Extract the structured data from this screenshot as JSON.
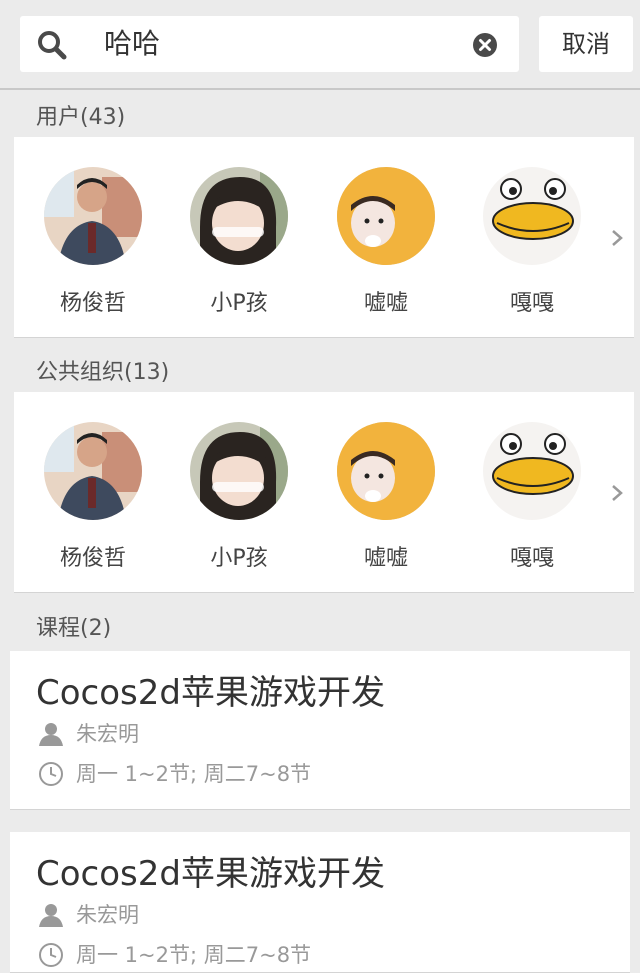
{
  "search": {
    "query": "哈哈",
    "cancel_label": "取消"
  },
  "sections": {
    "users": {
      "title": "用户(43)"
    },
    "orgs": {
      "title": "公共组织(13)"
    },
    "courses": {
      "title": "课程(2)"
    }
  },
  "users": [
    {
      "name": "杨俊哲",
      "avatar": "photo-man"
    },
    {
      "name": "小P孩",
      "avatar": "photo-girl"
    },
    {
      "name": "嘘嘘",
      "avatar": "photo-child-yellow-hood"
    },
    {
      "name": "嘎嘎",
      "avatar": "cartoon-duck"
    }
  ],
  "orgs": [
    {
      "name": "杨俊哲",
      "avatar": "photo-man"
    },
    {
      "name": "小P孩",
      "avatar": "photo-girl"
    },
    {
      "name": "嘘嘘",
      "avatar": "photo-child-yellow-hood"
    },
    {
      "name": "嘎嘎",
      "avatar": "cartoon-duck"
    }
  ],
  "courses": [
    {
      "title": "Cocos2d苹果游戏开发",
      "teacher": "朱宏明",
      "schedule": "周一 1~2节; 周二7~8节"
    },
    {
      "title": "Cocos2d苹果游戏开发",
      "teacher": "朱宏明",
      "schedule": "周一 1~2节; 周二7~8节"
    }
  ],
  "colors": {
    "background": "#ebebeb",
    "card": "#ffffff",
    "meta": "#999999"
  }
}
